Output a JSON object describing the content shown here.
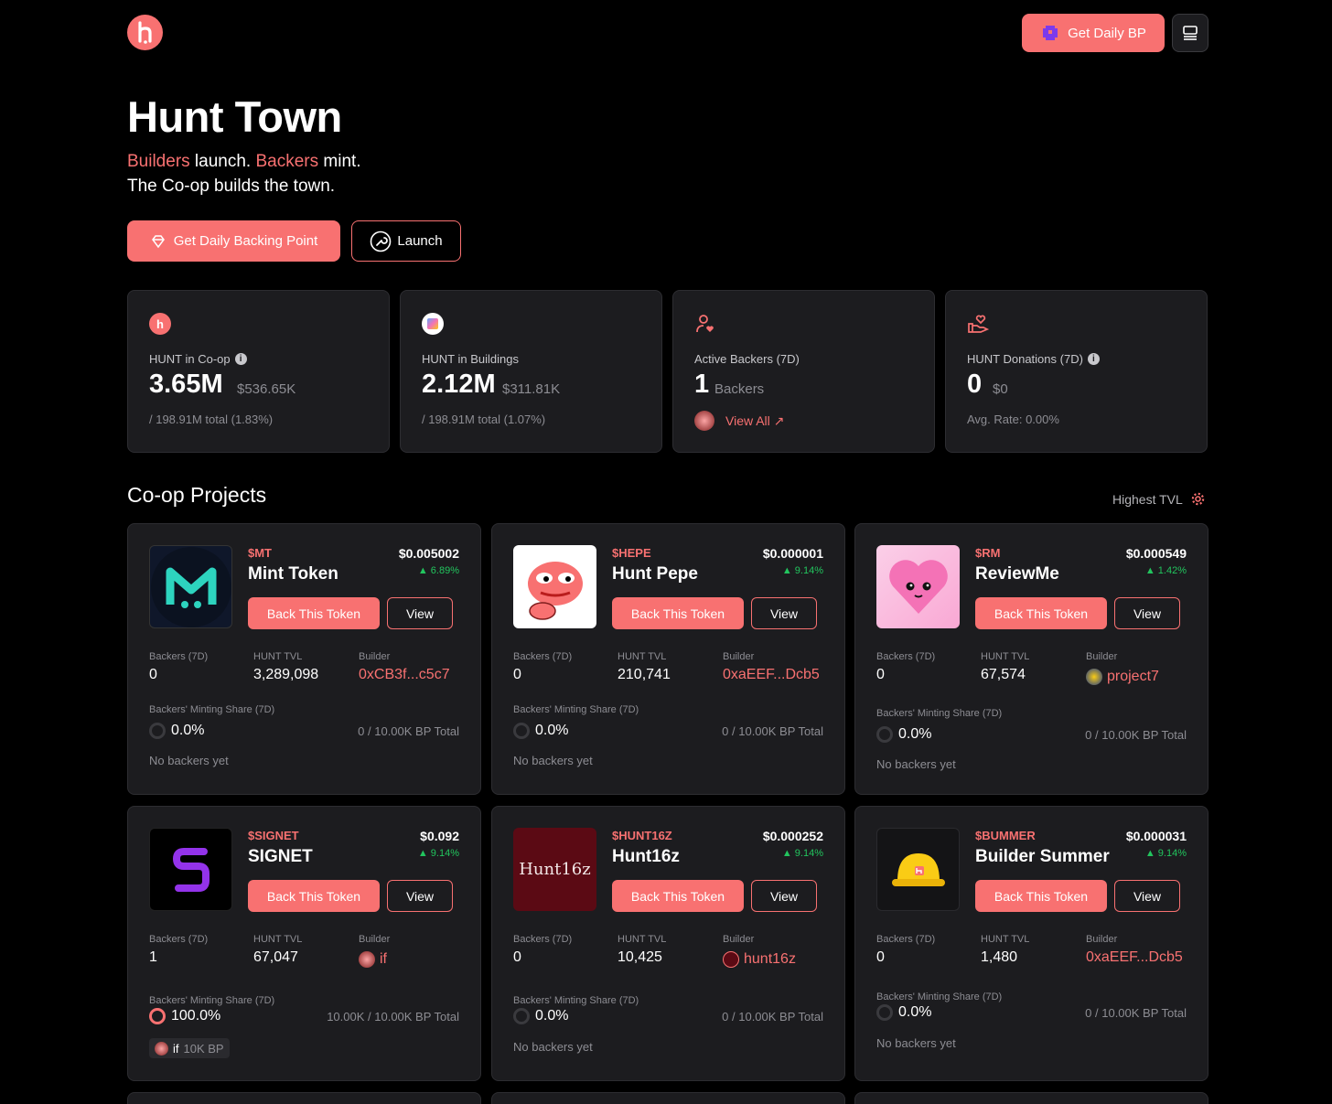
{
  "header": {
    "get_bp_label": "Get Daily BP"
  },
  "hero": {
    "title": "Hunt Town",
    "line1_builders": "Builders",
    "line1_launch": " launch. ",
    "line1_backers": "Backers",
    "line1_mint": " mint.",
    "line2": "The Co-op builds the town.",
    "primary_label": "Get Daily Backing Point",
    "launch_label": "Launch"
  },
  "stats": [
    {
      "label": "HUNT in Co-op",
      "value": "3.65M",
      "sub": "$536.65K",
      "foot": "/ 198.91M total (1.83%)"
    },
    {
      "label": "HUNT in Buildings",
      "value": "2.12M",
      "sub": "$311.81K",
      "foot": "/ 198.91M total (1.07%)"
    },
    {
      "label": "Active Backers (7D)",
      "value": "1",
      "sub": "Backers",
      "foot": "View All ↗"
    },
    {
      "label": "HUNT Donations (7D)",
      "value": "0",
      "sub": "$0",
      "foot": "Avg. Rate: 0.00%"
    }
  ],
  "projects_section": {
    "title": "Co-op Projects",
    "sort_label": "Highest TVL"
  },
  "labels": {
    "back": "Back This Token",
    "view": "View",
    "backers": "Backers (7D)",
    "tvl": "HUNT TVL",
    "builder": "Builder",
    "share": "Backers' Minting Share (7D)",
    "no_backers": "No backers yet"
  },
  "projects": [
    {
      "ticker": "$MT",
      "name": "Mint Token",
      "price": "$0.005002",
      "change": "▲ 6.89%",
      "backers": "0",
      "tvl": "3,289,098",
      "builder": "0xCB3f...c5c7",
      "share": "0.0%",
      "total": "0 / 10.00K BP Total",
      "footer": "No backers yet"
    },
    {
      "ticker": "$HEPE",
      "name": "Hunt Pepe",
      "price": "$0.000001",
      "change": "▲ 9.14%",
      "backers": "0",
      "tvl": "210,741",
      "builder": "0xaEEF...Dcb5",
      "share": "0.0%",
      "total": "0 / 10.00K BP Total",
      "footer": "No backers yet"
    },
    {
      "ticker": "$RM",
      "name": "ReviewMe",
      "price": "$0.000549",
      "change": "▲ 1.42%",
      "backers": "0",
      "tvl": "67,574",
      "builder": "project7",
      "share": "0.0%",
      "total": "0 / 10.00K BP Total",
      "footer": "No backers yet"
    },
    {
      "ticker": "$SIGNET",
      "name": "SIGNET",
      "price": "$0.092",
      "change": "▲ 9.14%",
      "backers": "1",
      "tvl": "67,047",
      "builder": "if",
      "share": "100.0%",
      "total": "10.00K / 10.00K BP Total",
      "chip_name": "if",
      "chip_bp": "10K BP"
    },
    {
      "ticker": "$HUNT16Z",
      "name": "Hunt16z",
      "price": "$0.000252",
      "change": "▲ 9.14%",
      "backers": "0",
      "tvl": "10,425",
      "builder": "hunt16z",
      "share": "0.0%",
      "total": "0 / 10.00K BP Total",
      "footer": "No backers yet",
      "logo_text": "Hunt16z"
    },
    {
      "ticker": "$BUMMER",
      "name": "Builder Summer",
      "price": "$0.000031",
      "change": "▲ 9.14%",
      "backers": "0",
      "tvl": "1,480",
      "builder": "0xaEEF...Dcb5",
      "share": "0.0%",
      "total": "0 / 10.00K BP Total",
      "footer": "No backers yet"
    }
  ],
  "colors": {
    "accent": "#f87171",
    "card": "#1c1c1f",
    "positive": "#22c55e",
    "background": "#000000"
  }
}
